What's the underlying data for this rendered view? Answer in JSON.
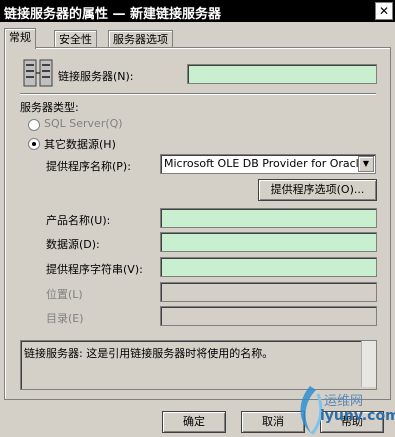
{
  "window": {
    "title": "链接服务器的属性 — 新建链接服务器",
    "close_glyph": "✕"
  },
  "tabs": [
    {
      "label": "常规",
      "active": true
    },
    {
      "label": "安全性",
      "active": false
    },
    {
      "label": "服务器选项",
      "active": false
    }
  ],
  "general": {
    "linked_server_label": "链接服务器(N):",
    "linked_server_value": "",
    "server_type_label": "服务器类型:",
    "sql_server_label": "SQL Server(Q)",
    "other_source_label": "其它数据源(H)",
    "provider_name_label": "提供程序名称(P):",
    "provider_name_value": "Microsoft OLE DB Provider for Oracle",
    "provider_options_button": "提供程序选项(O)...",
    "product_name_label": "产品名称(U):",
    "data_source_label": "数据源(D):",
    "provider_string_label": "提供程序字符串(V):",
    "location_label": "位置(L)",
    "catalog_label": "目录(E)",
    "description": "链接服务器: 这是引用链接服务器时将使用的名称。"
  },
  "buttons": {
    "ok": "确定",
    "cancel": "取消",
    "help": "帮助"
  },
  "watermark": {
    "line1": "运维网",
    "line2": "iyunv.com"
  },
  "colors": {
    "field_bg": "#c8f0d0",
    "title_bg": "#000000"
  }
}
